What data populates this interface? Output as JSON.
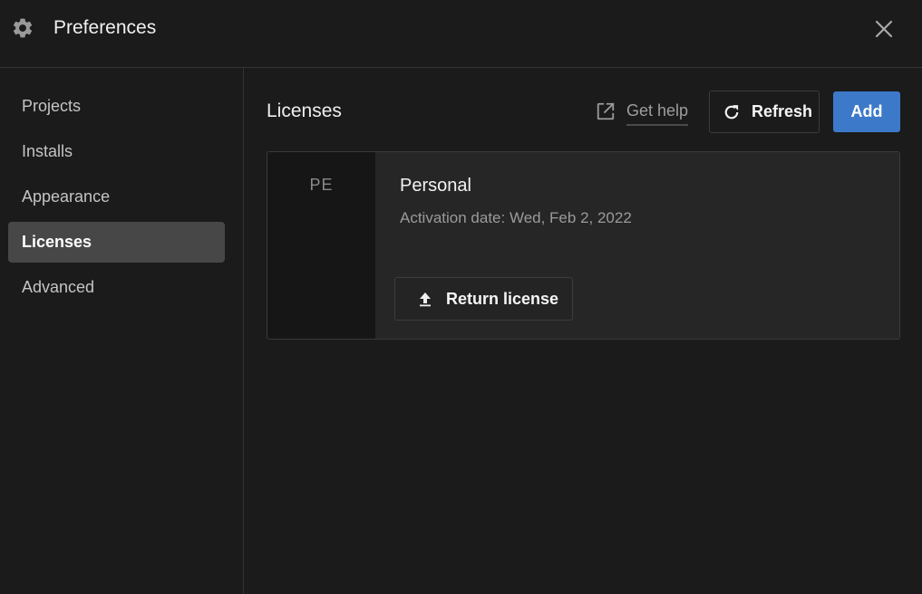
{
  "window": {
    "title": "Preferences",
    "icons": {
      "settings": "gear-icon",
      "close": "close-icon"
    }
  },
  "sidebar": {
    "items": [
      {
        "label": "Projects",
        "active": false
      },
      {
        "label": "Installs",
        "active": false
      },
      {
        "label": "Appearance",
        "active": false
      },
      {
        "label": "Licenses",
        "active": true
      },
      {
        "label": "Advanced",
        "active": false
      }
    ]
  },
  "main": {
    "title": "Licenses",
    "help_label": "Get help",
    "refresh_label": "Refresh",
    "add_label": "Add",
    "accent_color": "#3c79c9",
    "licenses": [
      {
        "badge": "PE",
        "name": "Personal",
        "activation": "Activation date: Wed, Feb 2, 2022",
        "return_label": "Return license"
      }
    ]
  }
}
